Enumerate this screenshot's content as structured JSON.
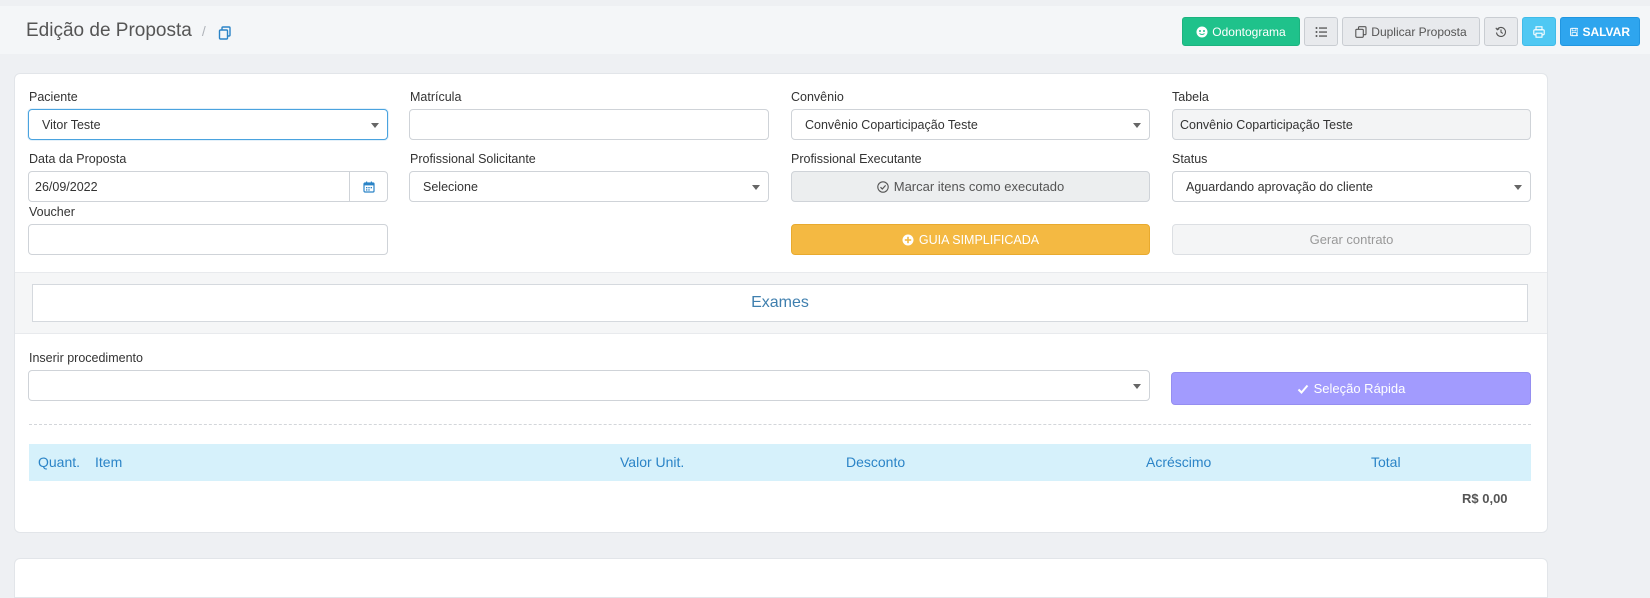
{
  "header": {
    "title": "Edição de Proposta",
    "separator": "/",
    "buttons": {
      "odontograma": "Odontograma",
      "duplicar": "Duplicar Proposta",
      "salvar": "SALVAR"
    }
  },
  "form": {
    "paciente": {
      "label": "Paciente",
      "value": "Vitor Teste"
    },
    "matricula": {
      "label": "Matrícula",
      "value": ""
    },
    "convenio": {
      "label": "Convênio",
      "value": "Convênio Coparticipação Teste"
    },
    "tabela": {
      "label": "Tabela",
      "value": "Convênio Coparticipação Teste"
    },
    "data_proposta": {
      "label": "Data da Proposta",
      "value": "26/09/2022"
    },
    "profissional_solicitante": {
      "label": "Profissional Solicitante",
      "value": "Selecione"
    },
    "profissional_executante": {
      "label": "Profissional Executante",
      "button": "Marcar itens como executado"
    },
    "status": {
      "label": "Status",
      "value": "Aguardando aprovação do cliente"
    },
    "voucher": {
      "label": "Voucher",
      "value": ""
    },
    "guia_button": "GUIA SIMPLIFICADA",
    "contrato_button": "Gerar contrato"
  },
  "exames": {
    "title": "Exames"
  },
  "procedimento": {
    "label": "Inserir procedimento",
    "value": "",
    "quick_button": "Seleção Rápida"
  },
  "table": {
    "columns": [
      "Quant.",
      "Item",
      "Valor Unit.",
      "Desconto",
      "Acréscimo",
      "Total"
    ],
    "total": "R$ 0,00"
  },
  "colors": {
    "odontograma": "#1fc28b",
    "salvar": "#2ea5ee",
    "guia": "#f4b942",
    "selecao_rapida": "#a29bfe",
    "table_header": "#d6f1fb"
  }
}
